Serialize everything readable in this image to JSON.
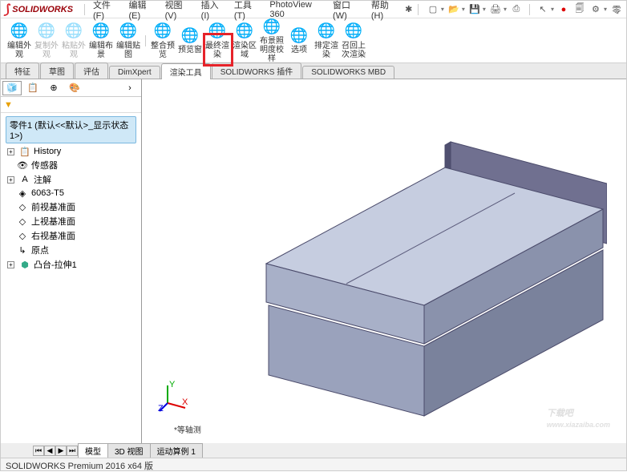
{
  "logo": {
    "text": "SOLIDWORKS"
  },
  "menu": [
    "文件(F)",
    "编辑(E)",
    "视图(V)",
    "插入(I)",
    "工具(T)",
    "PhotoView 360",
    "窗口(W)",
    "帮助(H)"
  ],
  "qat": {
    "icons": [
      "new-doc-icon",
      "open-icon",
      "save-icon",
      "print-icon",
      "screenshot-icon",
      "cursor-icon",
      "rebuild-icon",
      "options-icon",
      "gear-icon",
      "link-icon"
    ]
  },
  "ribbon": [
    {
      "icon": "🌐",
      "label": "编辑外观",
      "name": "edit-appearance"
    },
    {
      "icon": "🌐",
      "label": "复制外观",
      "name": "copy-appearance",
      "disabled": true
    },
    {
      "icon": "🌐",
      "label": "粘贴外观",
      "name": "paste-appearance",
      "disabled": true
    },
    {
      "icon": "🌐",
      "label": "编辑布景",
      "name": "edit-scene"
    },
    {
      "icon": "🌐",
      "label": "编辑贴图",
      "name": "edit-decal"
    },
    {
      "icon": "🌐",
      "label": "整合预览",
      "name": "integrated-preview"
    },
    {
      "icon": "🌐",
      "label": "预览窗",
      "name": "preview-window"
    },
    {
      "icon": "🌐",
      "label": "最终渲染",
      "name": "final-render"
    },
    {
      "icon": "🌐",
      "label": "渲染区域",
      "name": "render-region"
    },
    {
      "icon": "🌐",
      "label": "布景照明度校样",
      "name": "scene-illum"
    },
    {
      "icon": "🌐",
      "label": "选项",
      "name": "options"
    },
    {
      "icon": "🌐",
      "label": "排定渲染",
      "name": "schedule-render"
    },
    {
      "icon": "🌐",
      "label": "召回上次渲染",
      "name": "recall-render"
    }
  ],
  "tabs": [
    "特征",
    "草图",
    "评估",
    "DimXpert",
    "渲染工具",
    "SOLIDWORKS 插件",
    "SOLIDWORKS MBD"
  ],
  "active_tab": 4,
  "tree": {
    "root": "零件1 (默认<<默认>_显示状态 1>)",
    "items": [
      {
        "icon": "📋",
        "label": "History",
        "exp": true
      },
      {
        "icon": "👁",
        "label": "传感器"
      },
      {
        "icon": "A",
        "label": "注解",
        "exp": true
      },
      {
        "icon": "◈",
        "label": "6063-T5"
      },
      {
        "icon": "◇",
        "label": "前视基准面"
      },
      {
        "icon": "◇",
        "label": "上视基准面"
      },
      {
        "icon": "◇",
        "label": "右视基准面"
      },
      {
        "icon": "↳",
        "label": "原点"
      },
      {
        "icon": "⬢",
        "label": "凸台-拉伸1",
        "exp": true
      }
    ]
  },
  "viewlabel": "*等轴测",
  "bottom_tabs": [
    "模型",
    "3D 视图",
    "运动算例 1"
  ],
  "status": "SOLIDWORKS Premium 2016 x64 版",
  "watermark": {
    "big": "下载吧",
    "small": "www.xiazaiba.com"
  }
}
